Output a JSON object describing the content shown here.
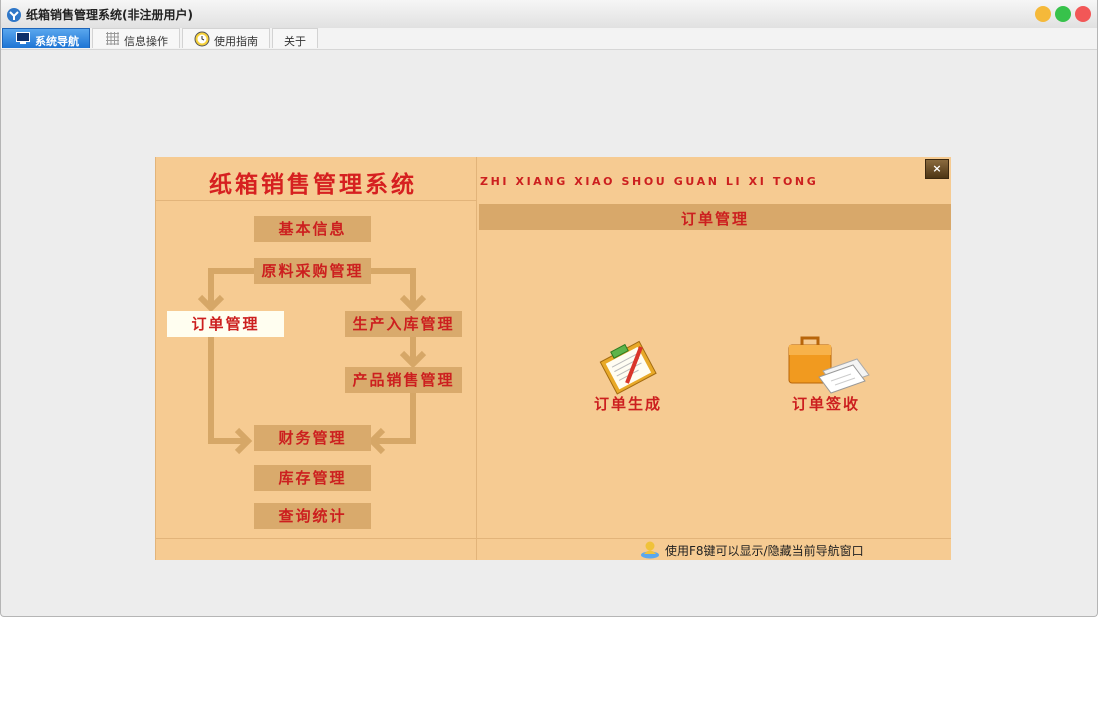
{
  "window": {
    "title": "纸箱销售管理系统(非注册用户)",
    "controls": {
      "minimize_color": "#f5b93a",
      "maximize_color": "#37c24b",
      "close_color": "#f25757"
    }
  },
  "tabs": [
    {
      "label": "系统导航",
      "icon": "monitor-icon",
      "active": true
    },
    {
      "label": "信息操作",
      "icon": "grid-icon",
      "active": false
    },
    {
      "label": "使用指南",
      "icon": "clock-icon",
      "active": false
    },
    {
      "label": "关于",
      "icon": "",
      "active": false
    }
  ],
  "nav": {
    "system_title": "纸箱销售管理系统",
    "pinyin_title": "ZHI XIANG XIAO SHOU GUAN LI XI TONG",
    "close_label": "×",
    "flow": {
      "basic_info": "基本信息",
      "purchase": "原料采购管理",
      "order": "订单管理",
      "production": "生产入库管理",
      "sales": "产品销售管理",
      "finance": "财务管理",
      "inventory": "库存管理",
      "query": "查询统计"
    },
    "section_title": "订单管理",
    "actions": [
      {
        "label": "订单生成",
        "icon": "clipboard-pencil-icon"
      },
      {
        "label": "订单签收",
        "icon": "briefcase-documents-icon"
      }
    ],
    "hint": "使用F8键可以显示/隐藏当前导航窗口"
  },
  "colors": {
    "panel_bg": "#f6cb92",
    "button_bg": "#d9aa6c",
    "accent_text": "#cc1f1f",
    "arrow": "#d6a767"
  }
}
